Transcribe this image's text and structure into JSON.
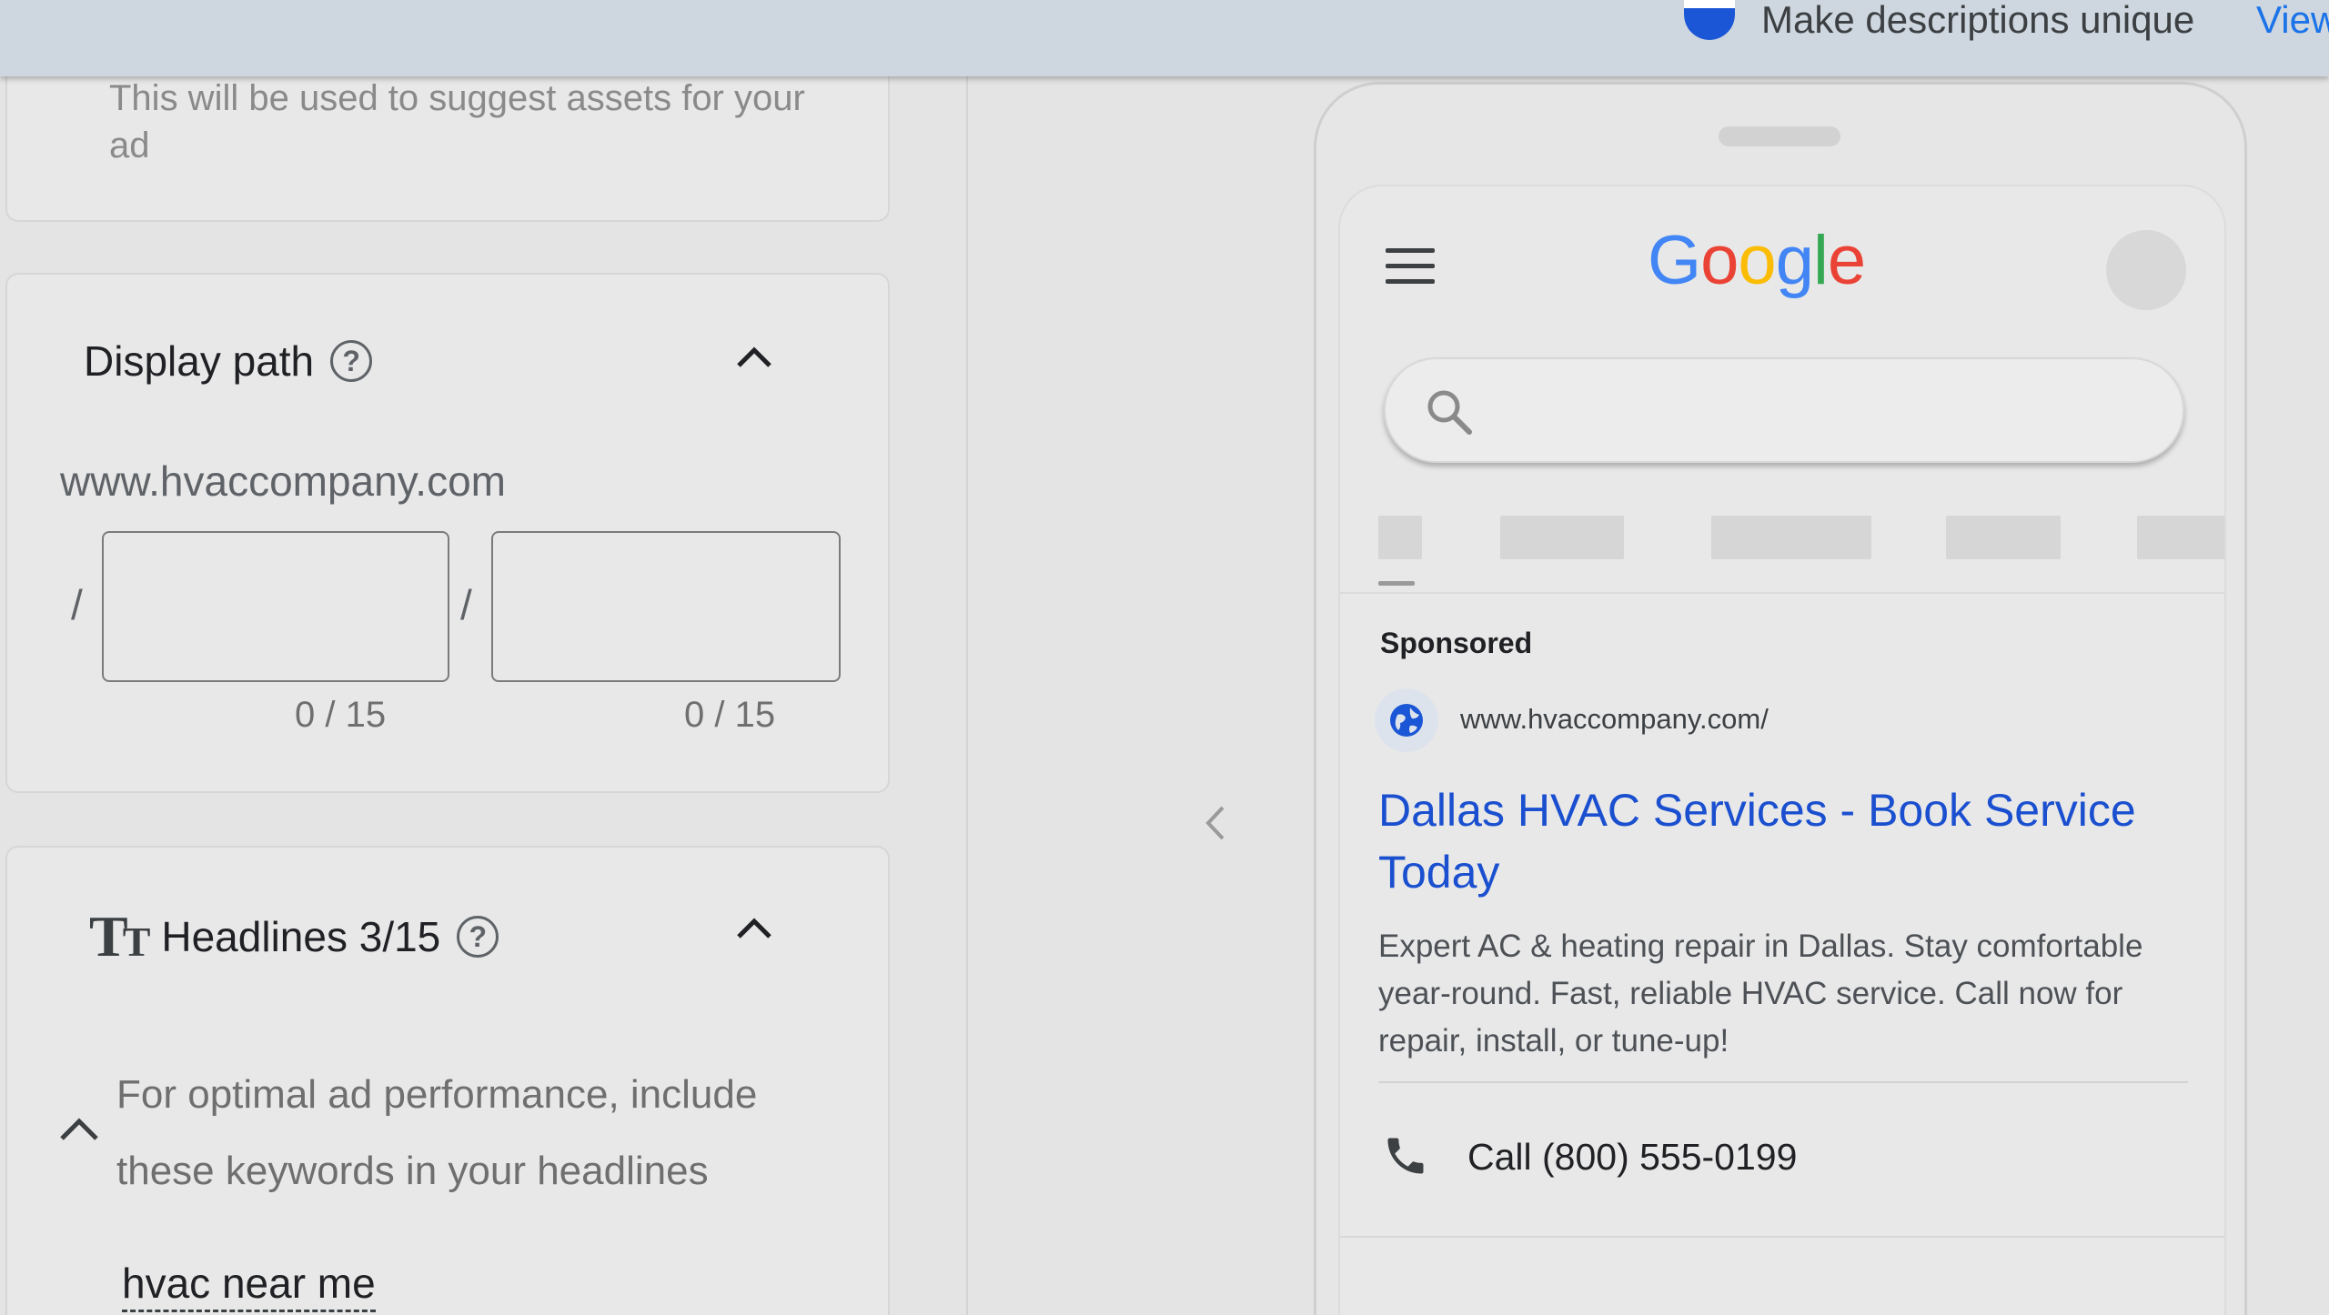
{
  "banner": {
    "message": "Make descriptions unique",
    "link": "View"
  },
  "left": {
    "hint_text": "This will be used to suggest assets for your ad",
    "display_path": {
      "title": "Display path",
      "domain": "www.hvaccompany.com",
      "separator": "/",
      "path1": {
        "value": "",
        "counter": "0 / 15"
      },
      "path2": {
        "value": "",
        "counter": "0 / 15"
      }
    },
    "headlines": {
      "title": "Headlines 3/15",
      "icon_glyph": "T",
      "keyword_tip": "For optimal ad performance, include these keywords in your headlines",
      "keyword": "hvac near me"
    }
  },
  "preview": {
    "logo": [
      "G",
      "o",
      "o",
      "g",
      "l",
      "e"
    ],
    "logo_colors": [
      "#4285F4",
      "#EA4335",
      "#FBBC05",
      "#4285F4",
      "#34A853",
      "#EA4335"
    ],
    "sponsored_label": "Sponsored",
    "ad_url": "www.hvaccompany.com/",
    "ad_headline": "Dallas HVAC Services - Book Service Today",
    "ad_description": "Expert AC & heating repair in Dallas. Stay comfortable year-round. Fast, reliable HVAC service. Call now for repair, install, or tune-up!",
    "call_text": "Call (800) 555-0199"
  },
  "colors": {
    "link_blue": "#1a73e8",
    "headline_blue": "#1a4fcf"
  },
  "icons": [
    "help-icon",
    "chevron-up-icon",
    "text-size-icon",
    "chevron-left-icon",
    "menu-icon",
    "search-icon",
    "globe-icon",
    "phone-icon"
  ]
}
